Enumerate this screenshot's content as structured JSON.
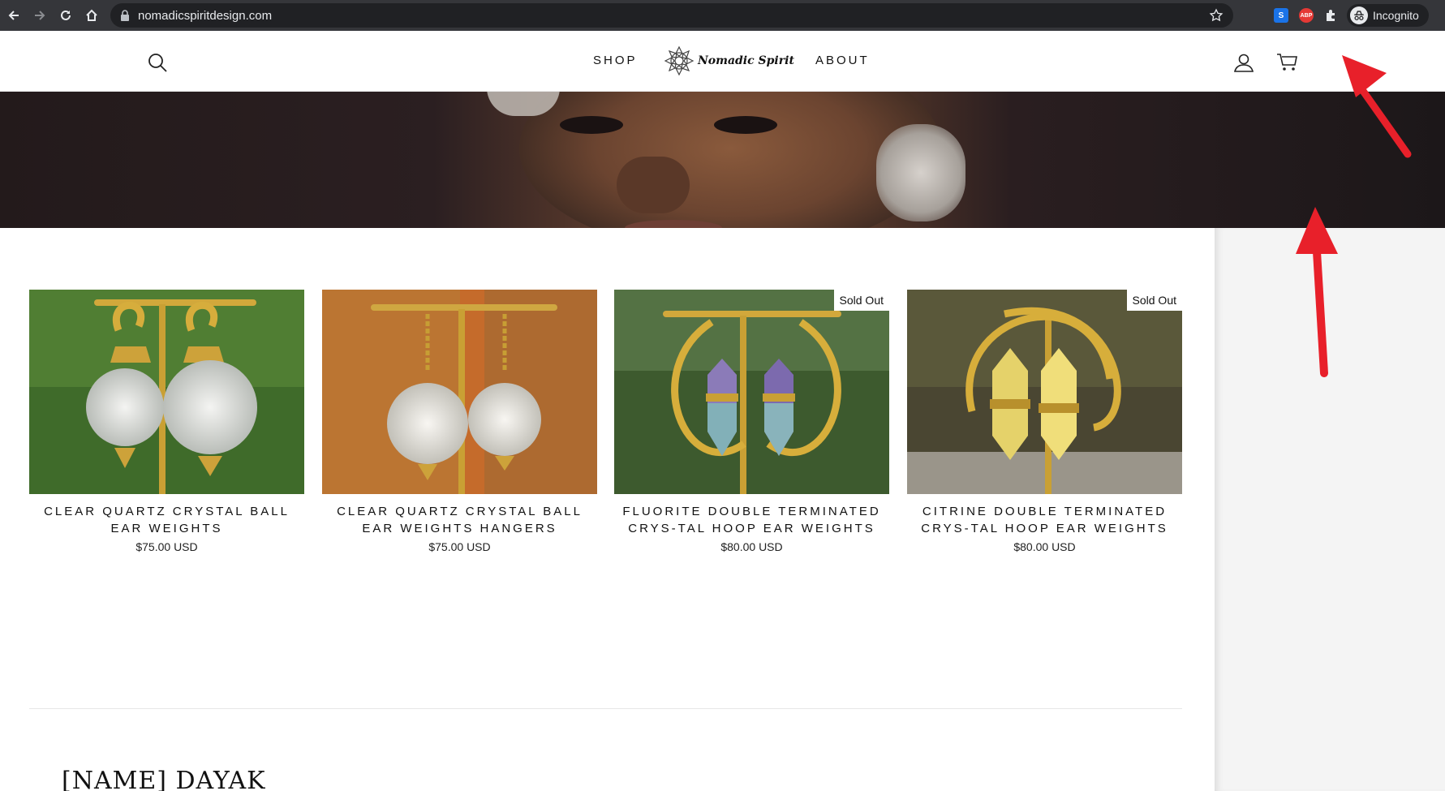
{
  "browser": {
    "url": "nomadicspiritdesign.com",
    "profile_label": "Incognito",
    "extensions": [
      {
        "name": "S",
        "color": "#1a73e8"
      },
      {
        "name": "ABP",
        "color": "#e53935"
      }
    ]
  },
  "header": {
    "nav_left": "SHOP",
    "nav_right": "ABOUT",
    "logo_text": "Nomadic Spirit"
  },
  "products": [
    {
      "title": "CLEAR QUARTZ CRYSTAL BALL EAR WEIGHTS",
      "price": "$75.00 USD",
      "sold_out": ""
    },
    {
      "title": "CLEAR QUARTZ CRYSTAL BALL EAR WEIGHTS HANGERS",
      "price": "$75.00 USD",
      "sold_out": ""
    },
    {
      "title": "FLUORITE DOUBLE TERMINATED CRYS-TAL HOOP EAR WEIGHTS",
      "price": "$80.00 USD",
      "sold_out": "Sold Out"
    },
    {
      "title": "CITRINE DOUBLE TERMINATED CRYS-TAL HOOP EAR WEIGHTS",
      "price": "$80.00 USD",
      "sold_out": "Sold Out"
    }
  ],
  "section": {
    "heading": "[NAME] DAYAK"
  },
  "colors": {
    "annotation_arrow": "#e8202a",
    "chrome_bg": "#35363a"
  }
}
